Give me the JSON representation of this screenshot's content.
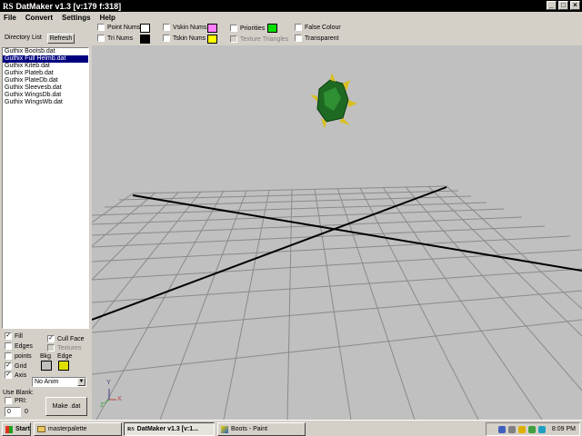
{
  "window": {
    "title_logo": "RS",
    "title": "DatMaker v1.3  [v:179 f:318]",
    "buttons": {
      "minimize": "_",
      "maximize": "□",
      "close": "×"
    }
  },
  "menu": [
    "File",
    "Convert",
    "Settings",
    "Help"
  ],
  "toolbar": {
    "directory_label": "Directory List",
    "refresh_label": "Refresh",
    "point_nums": "Point Nums",
    "tri_nums": "Tri Nums",
    "vskin_nums": "Vskin Nums",
    "tskin_nums": "Tskin Nums",
    "priorities": "Priorities",
    "texture_triangles": "Texture Triangles",
    "false_colour": "False Colour",
    "transparent": "Transparent",
    "colors": {
      "point_nums": "#ffffff",
      "tri_nums": "#000000",
      "vskin_nums": "#ff80ff",
      "tskin_nums": "#ffff00",
      "priorities": "#00e000"
    }
  },
  "files": [
    {
      "name": "Guthix Bootsb.dat",
      "selected": false
    },
    {
      "name": "Guthix Full Helmb.dat",
      "selected": true
    },
    {
      "name": "Guthix Kiteb.dat",
      "selected": false
    },
    {
      "name": "Guthix Plateb.dat",
      "selected": false
    },
    {
      "name": "Guthix PlateDb.dat",
      "selected": false
    },
    {
      "name": "Guthix Sleevesb.dat",
      "selected": false
    },
    {
      "name": "Guthix WingsDb.dat",
      "selected": false
    },
    {
      "name": "Guthix WingsWb.dat",
      "selected": false
    }
  ],
  "options": {
    "fill": "Fill",
    "fill_checked": true,
    "edges": "Edges",
    "edges_checked": false,
    "points": "points",
    "points_checked": false,
    "grid": "Grid",
    "grid_checked": true,
    "axis": "Axis",
    "axis_checked": true,
    "cull_face": "Cull Face",
    "cull_face_checked": true,
    "textures": "Textures",
    "bkg_label": "Bkg",
    "edge_label": "Edge",
    "bkg_color": "#c0c0c0",
    "edge_color": "#e0e000",
    "anim_select": "No Anim",
    "use_blank": "Use Blank:",
    "pri": "PRI:",
    "pri_value": "0",
    "pri_count": "0",
    "make_dat": "Make .dat"
  },
  "axis_labels": {
    "y": "Y",
    "z": "Z",
    "x": "X"
  },
  "taskbar": {
    "start": "Start",
    "tasks": [
      {
        "label": "masterpalette",
        "active": false
      },
      {
        "label": "DatMaker v1.3  [v:1...",
        "active": true
      },
      {
        "label": "Boots - Paint",
        "active": false
      }
    ],
    "clock": "8:09 PM"
  }
}
